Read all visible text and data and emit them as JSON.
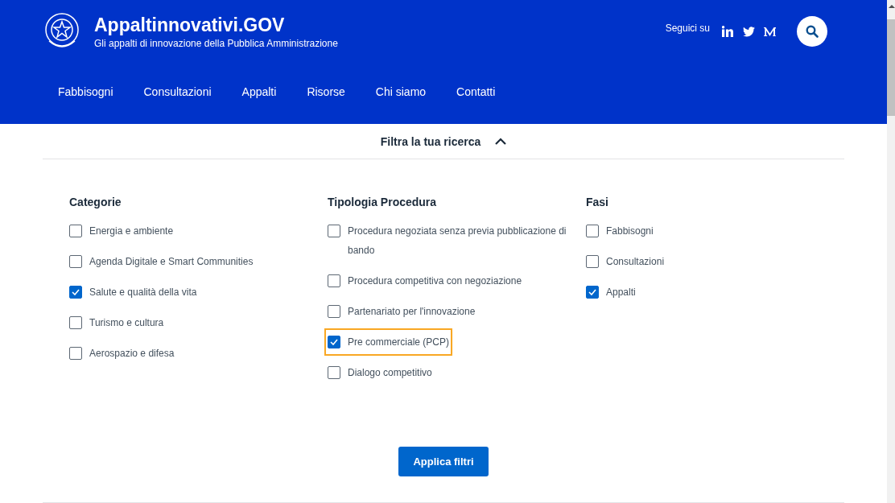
{
  "header": {
    "title": "Appaltinnovativi.GOV",
    "subtitle": "Gli appalti di innovazione della Pubblica Amministrazione",
    "social_label": "Seguici su"
  },
  "nav": [
    {
      "label": "Fabbisogni"
    },
    {
      "label": "Consultazioni"
    },
    {
      "label": "Appalti"
    },
    {
      "label": "Risorse"
    },
    {
      "label": "Chi siamo"
    },
    {
      "label": "Contatti"
    }
  ],
  "filter": {
    "title": "Filtra la tua ricerca",
    "expanded": true
  },
  "groups": [
    {
      "title": "Categorie",
      "options": [
        {
          "label": "Energia e ambiente",
          "checked": false,
          "focused": false
        },
        {
          "label": "Agenda Digitale e Smart Communities",
          "checked": false,
          "focused": false
        },
        {
          "label": "Salute e qualità della vita",
          "checked": true,
          "focused": false
        },
        {
          "label": "Turismo e cultura",
          "checked": false,
          "focused": false
        },
        {
          "label": "Aerospazio e difesa",
          "checked": false,
          "focused": false
        }
      ]
    },
    {
      "title": "Tipologia Procedura",
      "options": [
        {
          "label": "Procedura negoziata senza previa pubblicazione di bando",
          "checked": false,
          "focused": false
        },
        {
          "label": "Procedura competitiva con negoziazione",
          "checked": false,
          "focused": false
        },
        {
          "label": "Partenariato per l'innovazione",
          "checked": false,
          "focused": false
        },
        {
          "label": "Pre commerciale (PCP)",
          "checked": true,
          "focused": true
        },
        {
          "label": "Dialogo competitivo",
          "checked": false,
          "focused": false
        }
      ]
    },
    {
      "title": "Fasi",
      "options": [
        {
          "label": "Fabbisogni",
          "checked": false,
          "focused": false
        },
        {
          "label": "Consultazioni",
          "checked": false,
          "focused": false
        },
        {
          "label": "Appalti",
          "checked": true,
          "focused": false
        }
      ]
    }
  ],
  "apply_button": "Applica filtri"
}
